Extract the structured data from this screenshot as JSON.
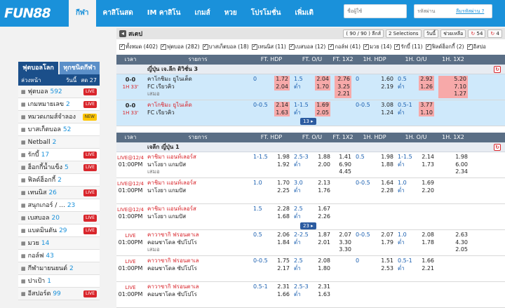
{
  "header": {
    "logo": "FUN88",
    "nav": [
      "กีฬา",
      "คาสิโนสด",
      "IM คาสิโน",
      "เกมส์",
      "หวย",
      "โปรโมชั่น",
      "เพิ่มเติ"
    ],
    "username_placeholder": "ชื่อผู้ใช้",
    "password_placeholder": "รหัสผ่าน",
    "forgot": "ลืมรหัสผ่าน ?"
  },
  "sidebar": {
    "tabs": [
      "ฟุตบอลโลก",
      "ทุกชนิดกีฬา"
    ],
    "sub_left": "ล่วงหน้า",
    "sub_mid": "วันนี้",
    "sub_right": "สด 27",
    "items": [
      {
        "label": "ฟุตบอล",
        "count": "592",
        "badge": "LIVE"
      },
      {
        "label": "เกมหมายเลข",
        "count": "2",
        "badge": "LIVE"
      },
      {
        "label": "หมวดเกมส์จำลอง",
        "count": "",
        "badge": "NEW"
      },
      {
        "label": "บาสเก็ตบอล",
        "count": "52",
        "badge": ""
      },
      {
        "label": "Netball",
        "count": "2",
        "badge": ""
      },
      {
        "label": "รักบี้",
        "count": "17",
        "badge": "LIVE"
      },
      {
        "label": "ฮ็อกกี้น้ำแข็ง",
        "count": "5",
        "badge": "LIVE"
      },
      {
        "label": "ฟิลด์ฮ็อกกี้",
        "count": "2",
        "badge": ""
      },
      {
        "label": "เทนนิส",
        "count": "26",
        "badge": "LIVE"
      },
      {
        "label": "สนุกเกอร์ / ...",
        "count": "23",
        "badge": ""
      },
      {
        "label": "เบสบอล",
        "count": "20",
        "badge": "LIVE"
      },
      {
        "label": "แบดมินตัน",
        "count": "29",
        "badge": "LIVE"
      },
      {
        "label": "มวย",
        "count": "14",
        "badge": ""
      },
      {
        "label": "กอล์ฟ",
        "count": "43",
        "badge": ""
      },
      {
        "label": "กีฬามายนยนต์",
        "count": "2",
        "badge": ""
      },
      {
        "label": "ปาเป้า",
        "count": "1",
        "badge": ""
      },
      {
        "label": "อีสปอร์ต",
        "count": "99",
        "badge": "LIVE"
      }
    ]
  },
  "main": {
    "title": "สเตป",
    "buttons": [
      "( 90 / 90 ) ลีกส์",
      "2 Selections",
      "วันนี้",
      "ช่วยเหลือ",
      "54",
      "4"
    ],
    "filters": [
      "ทั้งหมด (402)",
      "ฟุตบอล (282)",
      "บาสเก็ตบอล (18)",
      "เทนนิส (11)",
      "เบสบอล (12)",
      "กอล์ฟ (41)",
      "มวย (14)",
      "รักบี้ (11)",
      "ฟิลด์ฮ็อกกี้ (2)",
      "อีสปอ"
    ],
    "columns": [
      "เวลา",
      "รายการ",
      "FT. HDP",
      "FT. O/U",
      "FT. 1X2",
      "1H. HDP",
      "1H. O/U",
      "1H. 1X2"
    ],
    "more1": "13",
    "more2": "23",
    "section1": {
      "league": "ญี่ปุ่น เจ.ลีก ดิวิชั่น 3",
      "rows": [
        {
          "score": "0-0",
          "clock": "1H 33'",
          "t1": "คาโกชิมะ ยูไนเต็ด",
          "t2": "FC เรียวคิว",
          "t3": "เสมอ",
          "t1c": "t-blk",
          "t2c": "t-blk",
          "hdp_h": "0",
          "hdp_a": "",
          "hdp_p1": "1.72",
          "hdp_p2": "2.04",
          "ou_h": "1.5",
          "ou_a": "ต่ำ",
          "ou_p1": "2.04",
          "ou_p2": "1.70",
          "x12_1": "2.76",
          "x12_2": "3.25",
          "x12_3": "2.21",
          "h1hdp_h": "0",
          "h1hdp_p1": "1.60",
          "h1hdp_p2": "2.19",
          "h1ou_h": "0.5",
          "h1ou_a": "ต่ำ",
          "h1ou_p1": "2.92",
          "h1ou_p2": "1.26",
          "h1x_1": "5.20",
          "h1x_2": "7.10",
          "h1x_3": "1.27"
        },
        {
          "score": "0-0",
          "clock": "1H 33'",
          "t1": "คาโกชิมะ ยูไนเต็ด",
          "t2": "FC เรียวคิว",
          "t3": "",
          "t1c": "t-red",
          "t2c": "t-blk",
          "hdp_h": "0-0.5",
          "hdp_a": "",
          "hdp_p1": "2.14",
          "hdp_p2": "1.63",
          "ou_h": "1-1.5",
          "ou_a": "ต่ำ",
          "ou_p1": "1.69",
          "ou_p2": "2.05",
          "x12_1": "",
          "x12_2": "",
          "x12_3": "",
          "h1hdp_h": "0-0.5",
          "h1hdp_p1": "3.08",
          "h1hdp_p2": "1.24",
          "h1ou_h": "0.5-1",
          "h1ou_a": "ต่ำ",
          "h1ou_p1": "3.77",
          "h1ou_p2": "1.10",
          "h1x_1": "",
          "h1x_2": "",
          "h1x_3": ""
        }
      ]
    },
    "section2": {
      "league": "เจลีก ญี่ปุ่น 1",
      "rows": [
        {
          "live": "LIVE@12/4",
          "time": "01:00PM",
          "t1": "คาชิมา แอนท์เลอร์ส",
          "t2": "นาโงยา แกมปัส",
          "t3": "เสมอ",
          "hdp_h": "1-1.5",
          "hdp_p1": "1.98",
          "hdp_p2": "1.92",
          "ou_h": "2.5-3",
          "ou_a": "ต่ำ",
          "ou_p1": "1.88",
          "ou_p2": "2.00",
          "x12_1": "1.41",
          "x12_2": "6.90",
          "x12_3": "4.45",
          "h1hdp_h": "0.5",
          "h1hdp_p1": "1.98",
          "h1hdp_p2": "1.88",
          "h1ou_h": "1-1.5",
          "h1ou_a": "ต่ำ",
          "h1ou_p1": "2.14",
          "h1ou_p2": "1.73",
          "h1x_1": "1.98",
          "h1x_2": "6.00",
          "h1x_3": "2.34"
        },
        {
          "live": "LIVE@12/4",
          "time": "01:00PM",
          "t1": "คาชิมา แอนท์เลอร์ส",
          "t2": "นาโงยา แกมปัส",
          "t3": "",
          "hdp_h": "1.0",
          "hdp_p1": "1.70",
          "hdp_p2": "2.25",
          "ou_h": "3.0",
          "ou_a": "ต่ำ",
          "ou_p1": "2.13",
          "ou_p2": "1.76",
          "x12_1": "",
          "x12_2": "",
          "x12_3": "",
          "h1hdp_h": "0-0.5",
          "h1hdp_p1": "1.64",
          "h1hdp_p2": "2.28",
          "h1ou_h": "1.0",
          "h1ou_a": "ต่ำ",
          "h1ou_p1": "1.69",
          "h1ou_p2": "2.20",
          "h1x_1": "",
          "h1x_2": "",
          "h1x_3": ""
        },
        {
          "live": "LIVE@12/4",
          "time": "01:00PM",
          "t1": "คาชิมา แอนท์เลอร์ส",
          "t2": "นาโงยา แกมปัส",
          "t3": "",
          "hdp_h": "1.5",
          "hdp_p1": "2.28",
          "hdp_p2": "1.68",
          "ou_h": "2.5",
          "ou_a": "ต่ำ",
          "ou_p1": "1.67",
          "ou_p2": "2.26",
          "x12_1": "",
          "x12_2": "",
          "x12_3": "",
          "h1hdp_h": "",
          "h1hdp_p1": "",
          "h1hdp_p2": "",
          "h1ou_h": "",
          "h1ou_a": "",
          "h1ou_p1": "",
          "h1ou_p2": "",
          "h1x_1": "",
          "h1x_2": "",
          "h1x_3": ""
        },
        {
          "live": "LIVE",
          "time": "01:00PM",
          "t1": "คาวาซากิ ฟรอนตาเล",
          "t2": "คอนซาโดล ซัปโปโร",
          "t3": "เสมอ",
          "hdp_h": "0.5",
          "hdp_p1": "2.06",
          "hdp_p2": "1.84",
          "ou_h": "2-2.5",
          "ou_a": "ต่ำ",
          "ou_p1": "1.87",
          "ou_p2": "2.01",
          "x12_1": "2.07",
          "x12_2": "3.30",
          "x12_3": "3.30",
          "h1hdp_h": "0-0.5",
          "h1hdp_p1": "2.07",
          "h1hdp_p2": "1.79",
          "h1ou_h": "1.0",
          "h1ou_a": "ต่ำ",
          "h1ou_p1": "2.08",
          "h1ou_p2": "1.78",
          "h1x_1": "2.63",
          "h1x_2": "4.30",
          "h1x_3": "2.05"
        },
        {
          "live": "LIVE",
          "time": "01:00PM",
          "t1": "คาวาซากิ ฟรอนตาเล",
          "t2": "คอนซาโดล ซัปโปโร",
          "t3": "",
          "hdp_h": "0-0.5",
          "hdp_p1": "1.75",
          "hdp_p2": "2.17",
          "ou_h": "2.5",
          "ou_a": "ต่ำ",
          "ou_p1": "2.08",
          "ou_p2": "1.80",
          "x12_1": "",
          "x12_2": "",
          "x12_3": "",
          "h1hdp_h": "0",
          "h1hdp_p1": "1.51",
          "h1hdp_p2": "2.53",
          "h1ou_h": "0.5-1",
          "h1ou_a": "ต่ำ",
          "h1ou_p1": "1.66",
          "h1ou_p2": "2.21",
          "h1x_1": "",
          "h1x_2": "",
          "h1x_3": ""
        },
        {
          "live": "LIVE",
          "time": "01:00PM",
          "t1": "คาวาซากิ ฟรอนตาเล",
          "t2": "คอนซาโดล ซัปโปโร",
          "t3": "",
          "hdp_h": "0.5-1",
          "hdp_p1": "2.31",
          "hdp_p2": "1.66",
          "ou_h": "2.5-3",
          "ou_a": "ต่ำ",
          "ou_p1": "2.31",
          "ou_p2": "1.63",
          "x12_1": "",
          "x12_2": "",
          "x12_3": "",
          "h1hdp_h": "",
          "h1hdp_p1": "",
          "h1hdp_p2": "",
          "h1ou_h": "",
          "h1ou_a": "",
          "h1ou_p1": "",
          "h1ou_p2": "",
          "h1x_1": "",
          "h1x_2": "",
          "h1x_3": ""
        }
      ]
    }
  }
}
